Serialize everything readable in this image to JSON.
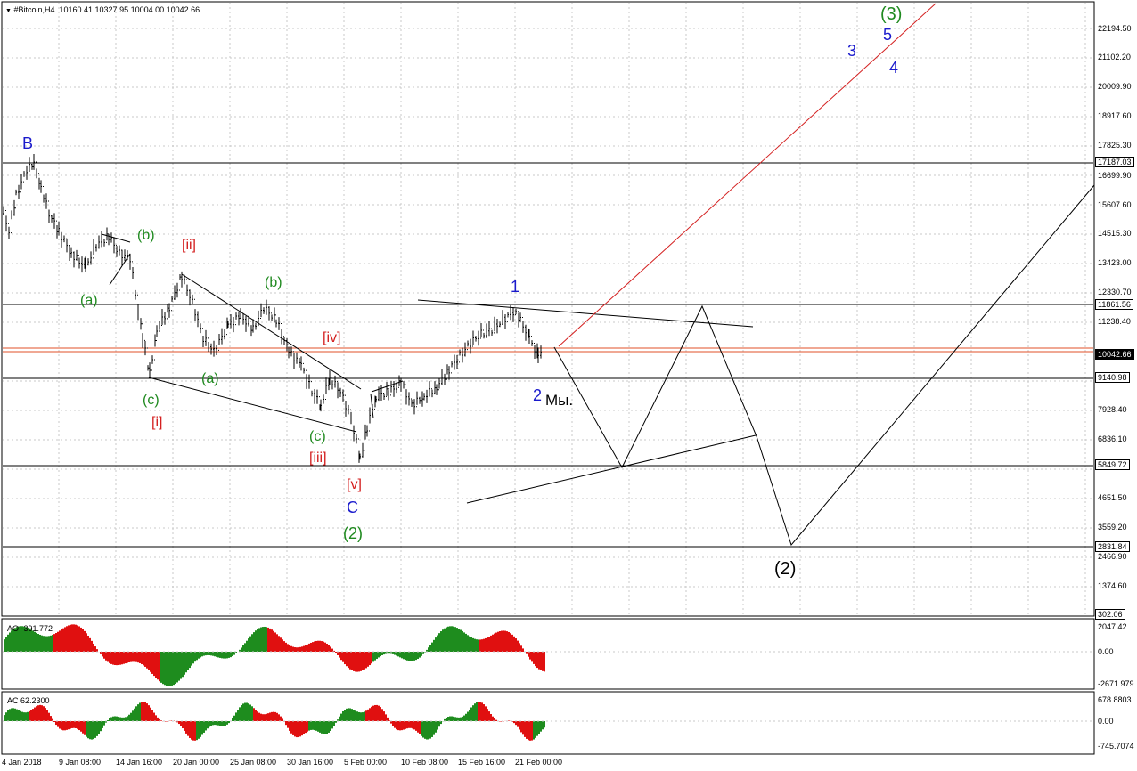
{
  "header": {
    "arrow_icon": "triangle-down-icon",
    "symbol": "#Bitcoin,H4",
    "ohlc": "10160.41 10327.95 10004.00 10042.66"
  },
  "price_axis": {
    "ticks": [
      "22194.50",
      "21102.20",
      "20009.90",
      "18917.60",
      "17825.30",
      "16699.90",
      "15607.60",
      "14515.30",
      "13423.00",
      "12330.70",
      "11238.40",
      "7928.40",
      "6836.10",
      "4651.50",
      "3559.20",
      "2466.90",
      "1374.60"
    ],
    "boxes": {
      "level_17187": "17187.03",
      "level_11861": "11861.56",
      "current": "10042.66",
      "level_9140": "9140.98",
      "level_5849": "5849.72",
      "level_2831": "2831.84",
      "level_302": "302.06"
    }
  },
  "time_axis": [
    "4 Jan 2018",
    "9 Jan 08:00",
    "14 Jan 16:00",
    "20 Jan 00:00",
    "25 Jan 08:00",
    "30 Jan 16:00",
    "5 Feb 00:00",
    "10 Feb 08:00",
    "15 Feb 16:00",
    "21 Feb 00:00"
  ],
  "ao": {
    "title": "AO -391.772",
    "ticks": [
      "2047.42",
      "0.00",
      "-2671.979"
    ]
  },
  "ac": {
    "title": "AC 62.2300",
    "ticks": [
      "678.8803",
      "0.00",
      "-745.7074"
    ]
  },
  "wave_labels": {
    "B": "B",
    "a1": "(a)",
    "b1": "(b)",
    "c1": "(c)",
    "i": "[i]",
    "ii": "[ii]",
    "a2": "(a)",
    "b2": "(b)",
    "iv": "[iv]",
    "c2": "(c)",
    "iii": "[iii]",
    "v": "[v]",
    "C": "C",
    "w2": "(2)",
    "one": "1",
    "two": "2",
    "my": "Мы.",
    "three": "3",
    "five": "5",
    "four": "4",
    "w3": "(3)",
    "w2b": "(2)"
  },
  "colors": {
    "blue": "#1a1acc",
    "green": "#1f8a1f",
    "red": "#d42020",
    "bull": "#1e8c1e",
    "bear": "#e01010",
    "trend": "#d42020",
    "grid": "#c8c8c8"
  }
}
